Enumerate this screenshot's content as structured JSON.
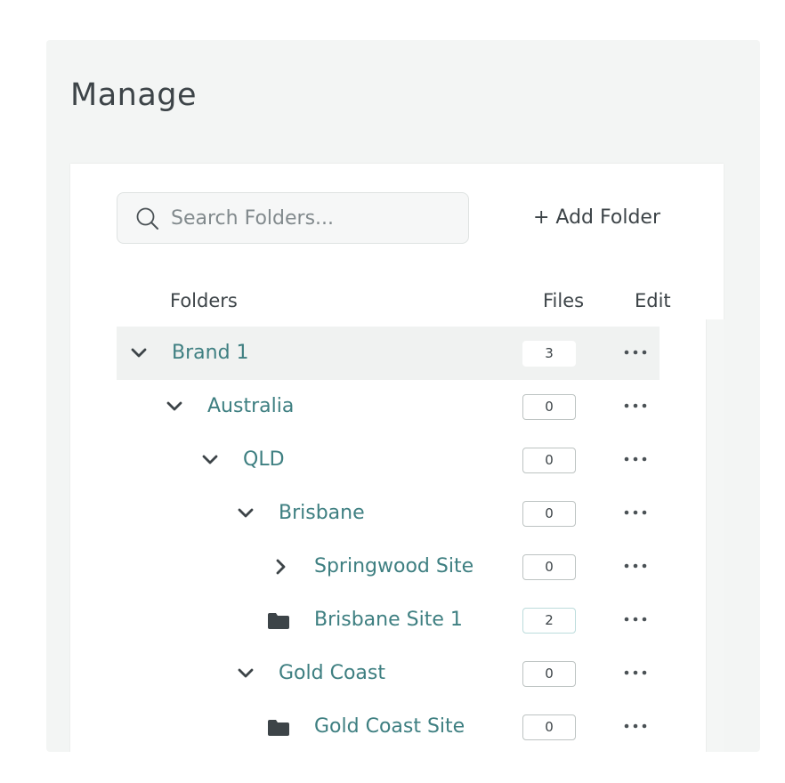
{
  "page": {
    "title": "Manage"
  },
  "toolbar": {
    "search_placeholder": "Search Folders...",
    "add_folder_label": "+ Add Folder"
  },
  "table": {
    "columns": {
      "folders": "Folders",
      "files": "Files",
      "edit": "Edit"
    },
    "rows": [
      {
        "name": "Brand 1",
        "files": "3",
        "depth": 0,
        "state": "expanded",
        "selected": true
      },
      {
        "name": "Australia",
        "files": "0",
        "depth": 1,
        "state": "expanded",
        "selected": false
      },
      {
        "name": "QLD",
        "files": "0",
        "depth": 2,
        "state": "expanded",
        "selected": false
      },
      {
        "name": "Brisbane",
        "files": "0",
        "depth": 3,
        "state": "expanded",
        "selected": false
      },
      {
        "name": "Springwood Site",
        "files": "0",
        "depth": 4,
        "state": "collapsed",
        "selected": false
      },
      {
        "name": "Brisbane Site 1",
        "files": "2",
        "depth": 4,
        "state": "leaf",
        "selected": false
      },
      {
        "name": "Gold Coast",
        "files": "0",
        "depth": 3,
        "state": "expanded",
        "selected": false
      },
      {
        "name": "Gold Coast Site",
        "files": "0",
        "depth": 4,
        "state": "leaf",
        "selected": false
      }
    ]
  },
  "icons": {
    "search": "search-icon",
    "expanded": "chevron-down-icon",
    "collapsed": "chevron-right-icon",
    "leaf": "folder-icon",
    "menu": "more-horizontal-icon"
  },
  "colors": {
    "link": "#3e7f81",
    "text": "#3d4448",
    "panel_bg": "#f3f5f4"
  }
}
